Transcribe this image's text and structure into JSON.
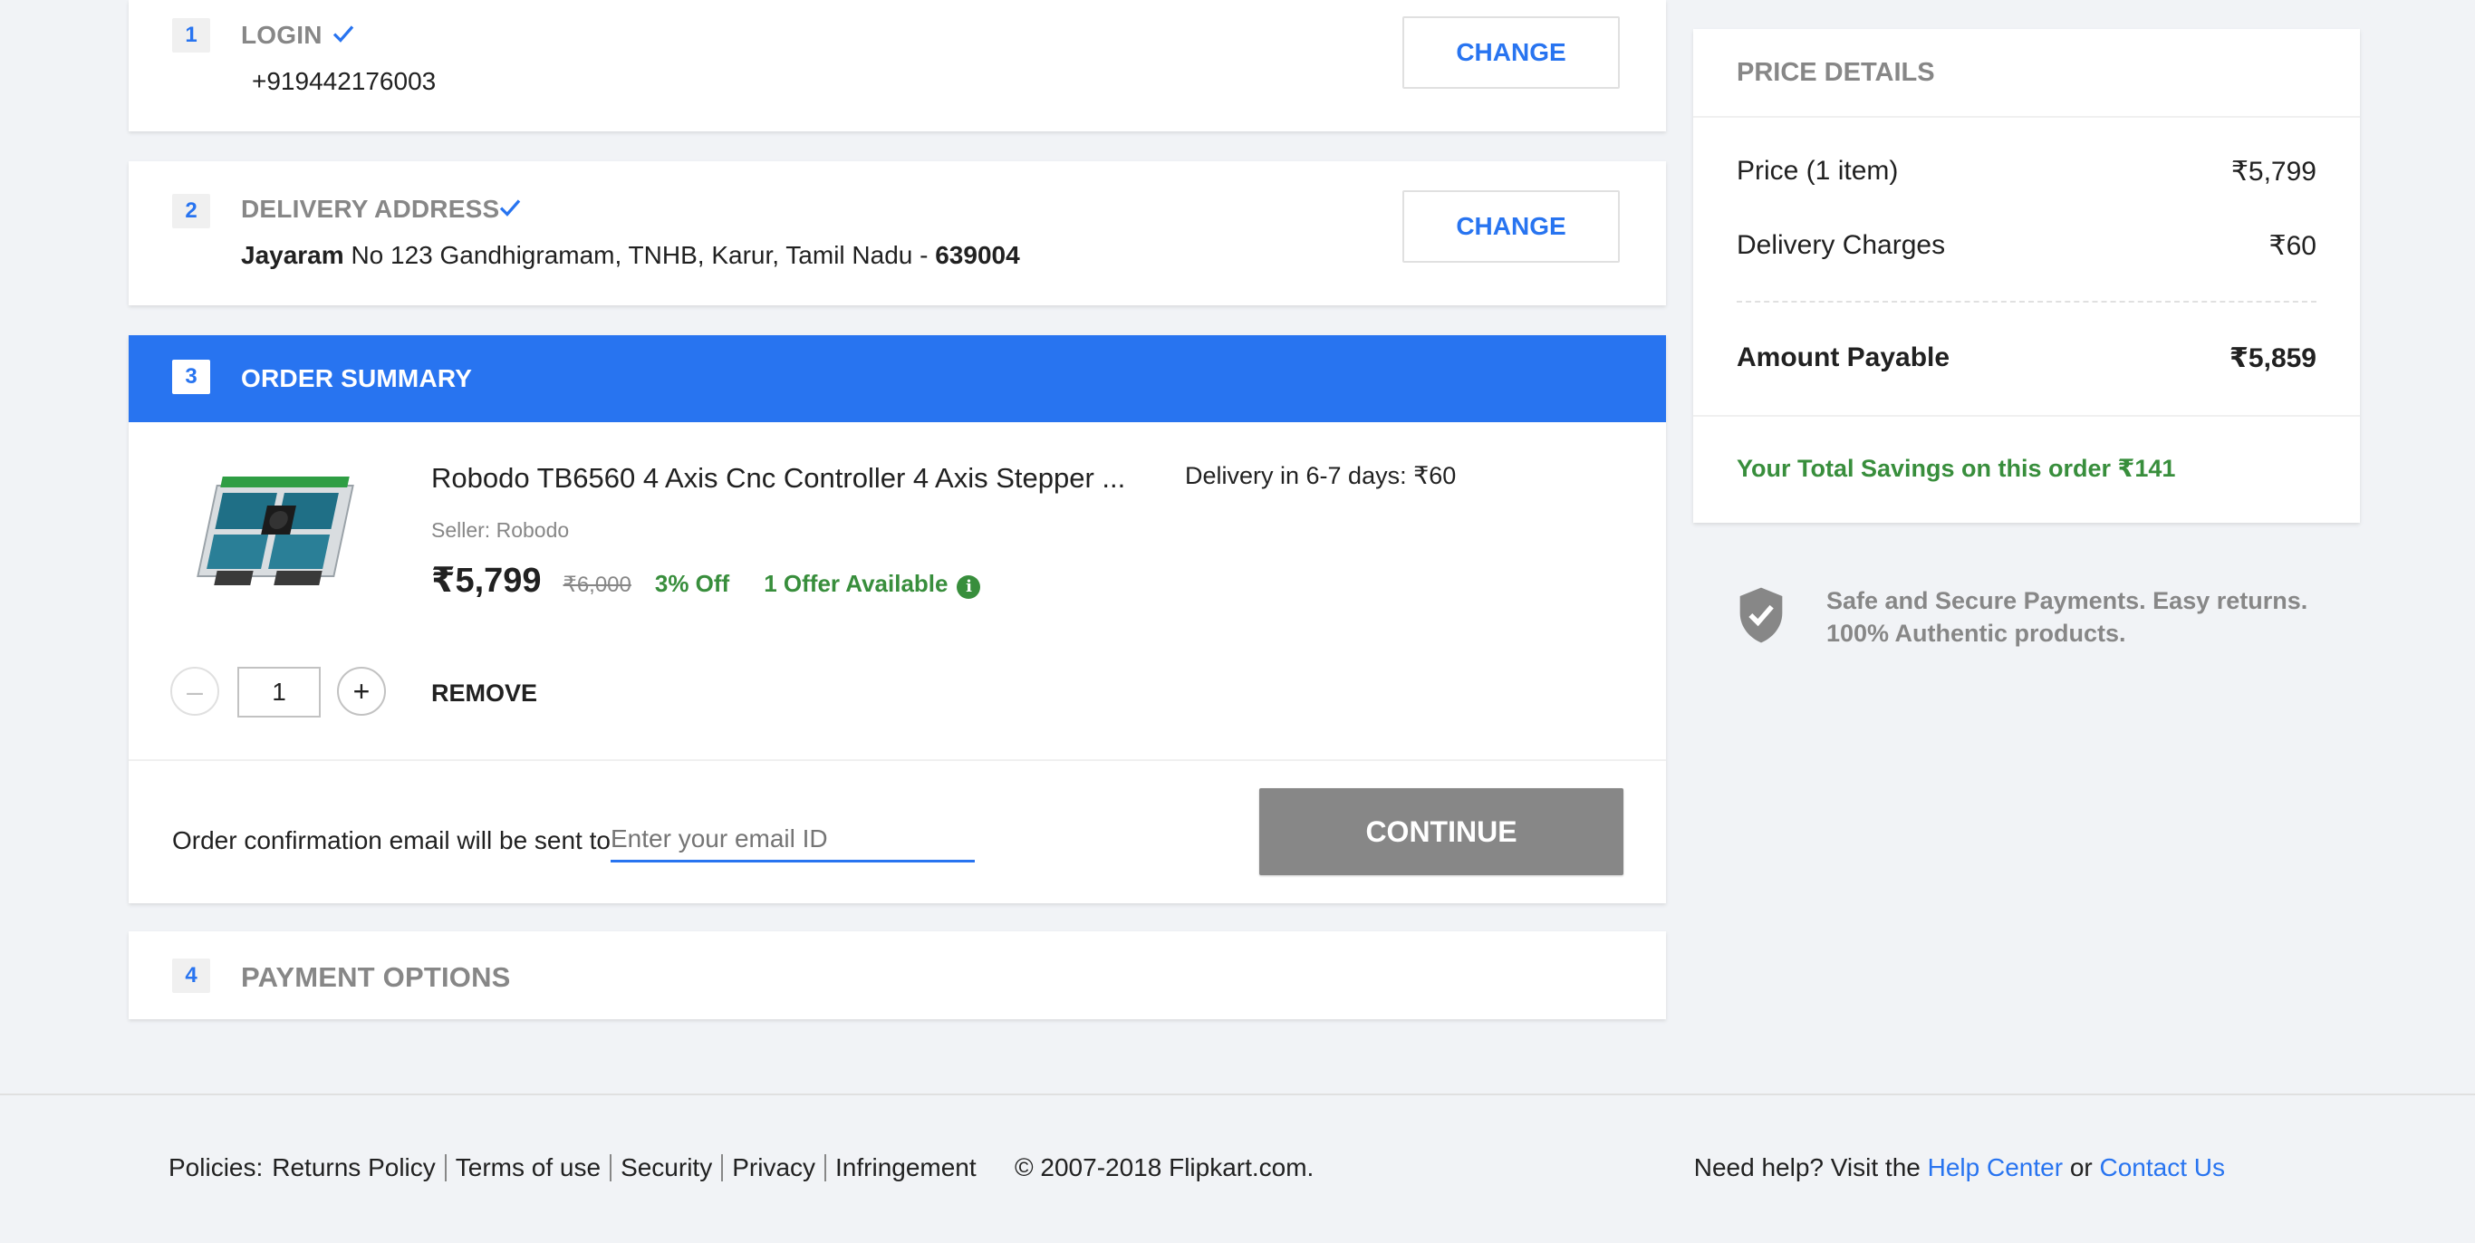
{
  "login": {
    "step": "1",
    "title": "LOGIN",
    "phone": "+919442176003",
    "change_label": "CHANGE"
  },
  "delivery": {
    "step": "2",
    "title": "DELIVERY ADDRESS",
    "name": "Jayaram",
    "address": "No 123 Gandhigramam, TNHB, Karur, Tamil Nadu - ",
    "pincode": "639004",
    "change_label": "CHANGE"
  },
  "order_summary": {
    "step": "3",
    "title": "ORDER SUMMARY",
    "item": {
      "name": "Robodo TB6560 4 Axis Cnc Controller 4 Axis Stepper ...",
      "seller": "Seller: Robodo",
      "price": "₹5,799",
      "mrp": "₹6,000",
      "discount": "3% Off",
      "offers": "1 Offer Available",
      "delivery": "Delivery in 6-7 days: ₹60",
      "quantity": "1",
      "remove_label": "REMOVE"
    },
    "email_prompt": "Order confirmation email will be sent to",
    "email_placeholder": "Enter your email ID",
    "continue_label": "CONTINUE"
  },
  "payment": {
    "step": "4",
    "title": "PAYMENT OPTIONS"
  },
  "price_details": {
    "title": "PRICE DETAILS",
    "price_label": "Price (1 item)",
    "price_value": "₹5,799",
    "delivery_label": "Delivery Charges",
    "delivery_value": "₹60",
    "payable_label": "Amount Payable",
    "payable_value": "₹5,859",
    "savings": "Your Total Savings on this order ₹141"
  },
  "trust": {
    "line1": "Safe and Secure Payments. Easy returns.",
    "line2": "100% Authentic products."
  },
  "footer": {
    "policies_label": "Policies:",
    "links": [
      "Returns Policy",
      "Terms of use",
      "Security",
      "Privacy",
      "Infringement"
    ],
    "copyright": "© 2007-2018 Flipkart.com.",
    "help_prefix": "Need help? Visit the",
    "help_center": "Help Center",
    "or": "or",
    "contact_us": "Contact Us"
  },
  "colors": {
    "brand_blue": "#2874f0",
    "green": "#388e3c",
    "continue_gray": "#878787"
  }
}
